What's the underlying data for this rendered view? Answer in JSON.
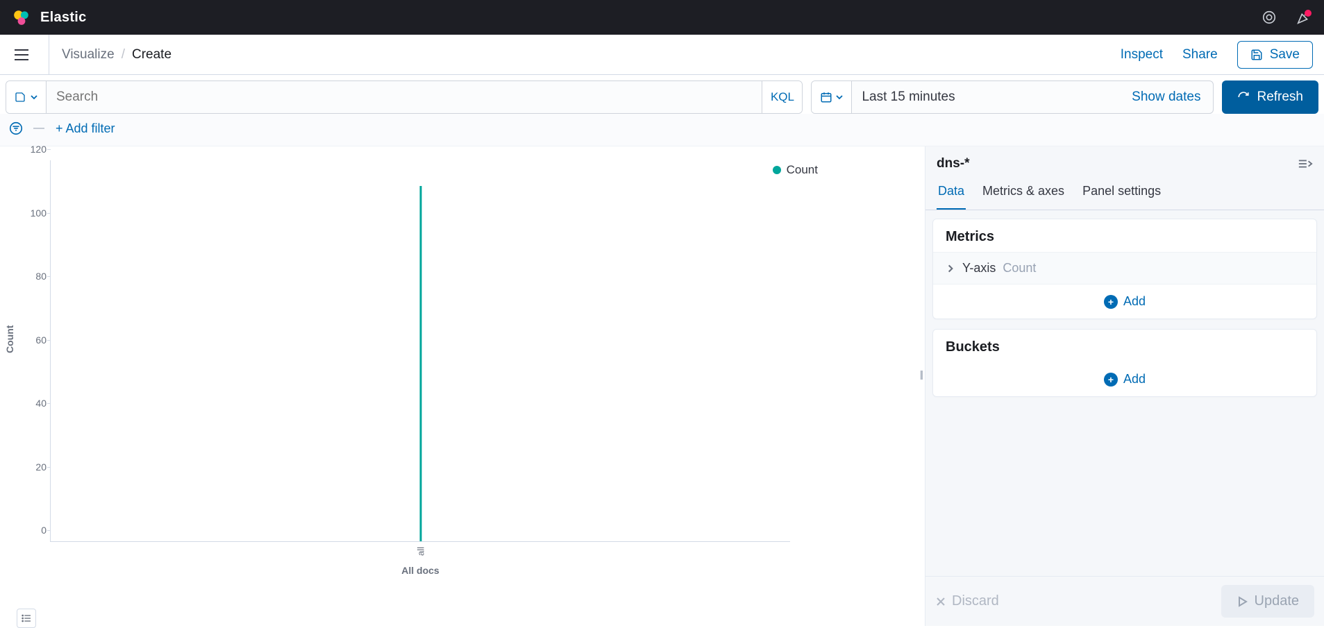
{
  "header": {
    "brand": "Elastic"
  },
  "subheader": {
    "breadcrumb_parent": "Visualize",
    "breadcrumb_current": "Create",
    "inspect": "Inspect",
    "share": "Share",
    "save": "Save"
  },
  "querybar": {
    "search_placeholder": "Search",
    "kql": "KQL",
    "time_range": "Last 15 minutes",
    "show_dates": "Show dates",
    "refresh": "Refresh"
  },
  "filters": {
    "add_filter": "+ Add filter"
  },
  "chart_data": {
    "type": "bar",
    "title": "",
    "xlabel": "All docs",
    "ylabel": "Count",
    "ylim": [
      0,
      120
    ],
    "y_ticks": [
      0,
      20,
      40,
      60,
      80,
      100,
      120
    ],
    "categories": [
      "all"
    ],
    "series": [
      {
        "name": "Count",
        "color": "#00a69b",
        "values": [
          112
        ]
      }
    ]
  },
  "sidepanel": {
    "index_pattern": "dns-*",
    "tabs": [
      "Data",
      "Metrics & axes",
      "Panel settings"
    ],
    "active_tab": 0,
    "metrics": {
      "title": "Metrics",
      "items": [
        {
          "label": "Y-axis",
          "value": "Count"
        }
      ],
      "add": "Add"
    },
    "buckets": {
      "title": "Buckets",
      "add": "Add"
    },
    "footer": {
      "discard": "Discard",
      "update": "Update"
    }
  }
}
